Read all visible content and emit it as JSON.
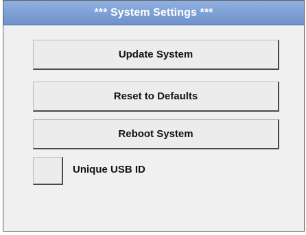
{
  "window": {
    "title": "***  System Settings  ***"
  },
  "actions": {
    "update_label": "Update System",
    "reset_label": "Reset to Defaults",
    "reboot_label": "Reboot System"
  },
  "options": {
    "unique_usb_id_label": "Unique USB ID",
    "unique_usb_id_checked": false
  },
  "colors": {
    "title_bar": "#7fa2d8",
    "title_text": "#ffffff",
    "background": "#f0f0f0"
  }
}
